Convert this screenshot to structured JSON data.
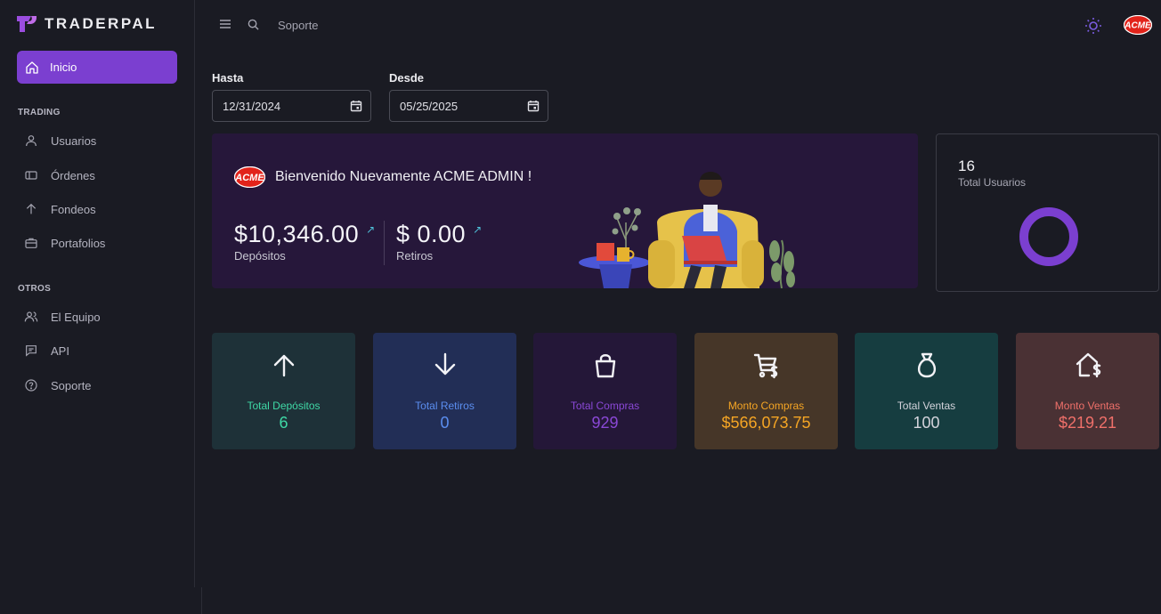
{
  "app": {
    "name": "TRADERPAL"
  },
  "sidebar": {
    "active": {
      "label": "Inicio"
    },
    "sections": [
      {
        "title": "TRADING",
        "items": [
          {
            "label": "Usuarios"
          },
          {
            "label": "Órdenes"
          },
          {
            "label": "Fondeos"
          },
          {
            "label": "Portafolios"
          }
        ]
      },
      {
        "title": "OTROS",
        "items": [
          {
            "label": "El Equipo"
          },
          {
            "label": "API"
          },
          {
            "label": "Soporte"
          }
        ]
      }
    ]
  },
  "header": {
    "search_label": "Soporte"
  },
  "filters": {
    "hasta": {
      "label": "Hasta",
      "value": "12/31/2024"
    },
    "desde": {
      "label": "Desde",
      "value": "05/25/2025"
    }
  },
  "welcome": {
    "title": "Bienvenido Nuevamente ACME ADMIN !",
    "deposits": {
      "amount": "$10,346.00",
      "label": "Depósitos"
    },
    "withdrawals": {
      "amount": "$ 0.00",
      "label": "Retiros"
    }
  },
  "users_card": {
    "count": "16",
    "label": "Total Usuarios"
  },
  "stats": [
    {
      "label": "Total Depósitos",
      "value": "6",
      "icon": "arrow-up-icon",
      "bg": "#1e3138",
      "color": "#3fd9a6"
    },
    {
      "label": "Total Retiros",
      "value": "0",
      "icon": "arrow-down-icon",
      "bg": "#222e56",
      "color": "#5b8ef0"
    },
    {
      "label": "Total Compras",
      "value": "929",
      "icon": "shopping-bag-icon",
      "bg": "#241738",
      "color": "#8a48d6"
    },
    {
      "label": "Monto Compras",
      "value": "$566,073.75",
      "icon": "cart-dollar-icon",
      "bg": "#463628",
      "color": "#f5a524"
    },
    {
      "label": "Total Ventas",
      "value": "100",
      "icon": "money-bag-icon",
      "bg": "#163d40",
      "color": "#d4d4dc"
    },
    {
      "label": "Monto Ventas",
      "value": "$219.21",
      "icon": "house-dollar-icon",
      "bg": "#4a3134",
      "color": "#f0706a"
    }
  ]
}
